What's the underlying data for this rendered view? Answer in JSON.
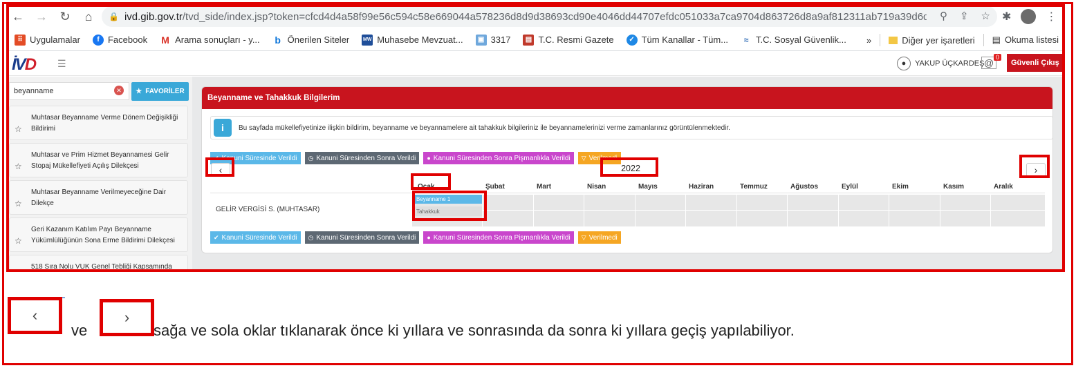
{
  "browser": {
    "url_host": "ivd.gib.gov.tr",
    "url_path": "/tvd_side/index.jsp?token=cfcd4d4a58f99e56c594c58e669044a578236d8d9d38693cd90e4046dd44707efdc051033a7ca9704d863726d8a9af812311ab719a39d6d59673837e...",
    "bookmarks": [
      "Uygulamalar",
      "Facebook",
      "Arama sonuçları - y...",
      "Önerilen Siteler",
      "Muhasebe Mevzuat...",
      "3317",
      "T.C. Resmi Gazete",
      "Tüm Kanallar - Tüm...",
      "T.C. Sosyal Güvenlik..."
    ],
    "bookmarks_more": "»",
    "other_bookmarks": "Diğer yer işaretleri",
    "reading_list": "Okuma listesi"
  },
  "header": {
    "logo_iv": "İV",
    "logo_d": "D",
    "user_name": "YAKUP ÜÇKARDEŞ",
    "mail_badge": "0",
    "logout_label": "Güvenli Çıkış"
  },
  "sidebar": {
    "search_value": "beyanname",
    "favorites_label": "FAVORİLER",
    "items": [
      "Muhtasar Beyanname Verme Dönem Değişikliği Bildirimi",
      "Muhtasar ve Prim Hizmet Beyannamesi Gelir Stopaj Mükellefiyeti Açılış Dilekçesi",
      "Muhtasar Beyanname Verilmeyeceğine Dair Dilekçe",
      "Geri Kazanım Katılım Payı Beyanname Yükümlülüğünün Sona Erme Bildirimi Dilekçesi",
      "518 Sıra Nolu VUK Genel Tebliği Kapsamında"
    ]
  },
  "panel": {
    "title": "Beyanname ve Tahakkuk Bilgilerim",
    "info_text": "Bu sayfada mükellefiyetinize ilişkin bildirim, beyanname ve beyannamelere ait tahakkuk bilgileriniz ile beyannamelerinizi verme zamanlarınız görüntülenmektedir.",
    "legend": [
      "Kanuni Süresinde Verildi",
      "Kanuni Süresinden Sonra Verildi",
      "Kanuni Süresinden Sonra Pişmanlıkla Verildi",
      "Verilmedi"
    ],
    "legend_colors": [
      "#5bb8e8",
      "#5d6873",
      "#c946cc",
      "#f5a623"
    ],
    "prev_label": "‹",
    "next_label": "›",
    "year": "2022",
    "months": [
      "Ocak",
      "Şubat",
      "Mart",
      "Nisan",
      "Mayıs",
      "Haziran",
      "Temmuz",
      "Ağustos",
      "Eylül",
      "Ekim",
      "Kasım",
      "Aralık"
    ],
    "row_label": "GELİR VERGİSİ S. (MUHTASAR)",
    "beyanname_label": "Beyanname 1",
    "tahakkuk_label": "Tahakkuk"
  },
  "caption": {
    "prev_arrow": "‹",
    "next_arrow": "›",
    "and_word": "ve",
    "text": "sağa ve sola oklar tıklanarak önce ki yıllara ve sonrasında da sonra ki yıllara geçiş yapılabiliyor."
  },
  "accent_color": "#e00000"
}
